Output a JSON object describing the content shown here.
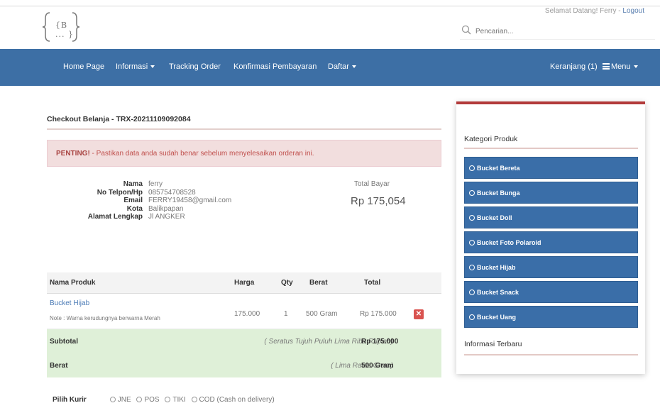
{
  "header": {
    "logo_text": "{B ... }",
    "welcome_text": "Selamat Datang! Ferry",
    "logout_label": "Logout",
    "search_placeholder": "Pencarian..."
  },
  "navbar": {
    "items": [
      {
        "label": "Home Page"
      },
      {
        "label": "Informasi"
      },
      {
        "label": "Tracking Order"
      },
      {
        "label": "Konfirmasi Pembayaran"
      },
      {
        "label": "Daftar"
      }
    ],
    "cart_label": "Keranjang (1)",
    "menu_label": "Menu"
  },
  "checkout": {
    "title": "Checkout Belanja - TRX-20211109092084",
    "alert_strong": "PENTING!",
    "alert_text": " - Pastikan data anda sudah benar sebelum menyelesaikan orderan ini.",
    "customer": {
      "labels": [
        "Nama",
        "No Telpon/Hp",
        "Email",
        "Kota",
        "Alamat Lengkap"
      ],
      "values": [
        "ferry",
        "085754708528",
        "FERRY19458@gmail.com",
        "Balikpapan",
        "Jl ANGKER"
      ]
    },
    "total_label": "Total Bayar",
    "total_amount": "Rp 175,054",
    "table": {
      "headers": [
        "Nama Produk",
        "Harga",
        "Qty",
        "Berat",
        "Total"
      ],
      "rows": [
        {
          "name": "Bucket Hijab",
          "note": "Note : Warna kerudungnya berwarna Merah",
          "harga": "175.000",
          "qty": "1",
          "berat": "500 Gram",
          "total": "Rp 175.000"
        }
      ],
      "subtotal_label": "Subtotal",
      "subtotal_words": "( Seratus Tujuh Puluh Lima Ribu Rupiah)",
      "subtotal_value": "Rp 175.000",
      "berat_label": "Berat",
      "berat_words": "( Lima Ratus Gram)",
      "berat_value": "500 Gram"
    },
    "kurir_label": "Pilih Kurir",
    "kurir_options": [
      "JNE",
      "POS",
      "TIKI",
      "COD (Cash on delivery)"
    ]
  },
  "sidebar": {
    "kategori_title": "Kategori Produk",
    "categories": [
      "Bucket Bereta",
      "Bucket Bunga",
      "Bucket Doll",
      "Bucket Foto Polaroid",
      "Bucket Hijab",
      "Bucket Snack",
      "Bucket Uang"
    ],
    "info_title": "Informasi Terbaru"
  },
  "colors": {
    "navbar": "#3d6fa5",
    "category_button": "#3a6ea8",
    "alert_bg": "#f2dede",
    "success_bg": "#dff0d8",
    "danger": "#d9534f"
  },
  "icons": [
    "search-icon",
    "menu-icon",
    "remove-icon",
    "category-icon",
    "caret-down-icon"
  ]
}
